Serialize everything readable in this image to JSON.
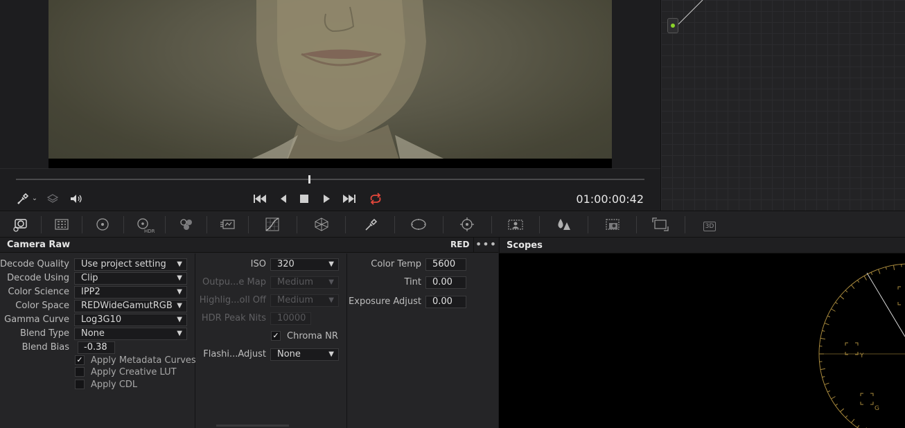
{
  "viewer": {
    "timecode": "01:00:00:42"
  },
  "icons": {
    "picker": "eyedropper-icon",
    "layers": "layers-icon",
    "audio": "speaker-icon",
    "first": "skip-first-icon",
    "prev": "step-back-icon",
    "stop": "stop-icon",
    "play": "play-icon",
    "last": "skip-last-icon",
    "loop": "loop-icon"
  },
  "toolbar": {
    "hdr_label": "HDR",
    "three_d_label": "3D"
  },
  "camera_raw": {
    "title": "Camera Raw",
    "badge": "RED",
    "menu": "•••",
    "left": {
      "decode_quality": {
        "label": "Decode Quality",
        "value": "Use project setting"
      },
      "decode_using": {
        "label": "Decode Using",
        "value": "Clip"
      },
      "color_science": {
        "label": "Color Science",
        "value": "IPP2"
      },
      "color_space": {
        "label": "Color Space",
        "value": "REDWideGamutRGB"
      },
      "gamma_curve": {
        "label": "Gamma Curve",
        "value": "Log3G10"
      },
      "blend_type": {
        "label": "Blend Type",
        "value": "None"
      },
      "blend_bias": {
        "label": "Blend Bias",
        "value": "-0.38"
      },
      "apply_metadata_curves": {
        "label": "Apply Metadata Curves",
        "checked": true
      },
      "apply_creative_lut": {
        "label": "Apply Creative LUT",
        "checked": false
      },
      "apply_cdl": {
        "label": "Apply CDL",
        "checked": false
      }
    },
    "middle": {
      "iso": {
        "label": "ISO",
        "value": "320"
      },
      "output_map": {
        "label": "Outpu...e Map",
        "value": "Medium"
      },
      "highlight_rolloff": {
        "label": "Highlig...oll Off",
        "value": "Medium"
      },
      "hdr_peak_nits": {
        "label": "HDR Peak Nits",
        "value": "10000"
      },
      "chroma_nr": {
        "label": "Chroma NR",
        "checked": true
      },
      "flashing_adjust": {
        "label": "Flashi...Adjust",
        "value": "None"
      }
    },
    "right": {
      "color_temp": {
        "label": "Color Temp",
        "value": "5600"
      },
      "tint": {
        "label": "Tint",
        "value": "0.00"
      },
      "exposure_adjust": {
        "label": "Exposure Adjust",
        "value": "0.00"
      }
    }
  },
  "scopes": {
    "title": "Scopes",
    "marks": {
      "y": "Y",
      "g": "G"
    }
  },
  "colors": {
    "loop_active": "#e4473b",
    "node_green": "#8bd42a",
    "scope_gold": "#a98a3d"
  }
}
